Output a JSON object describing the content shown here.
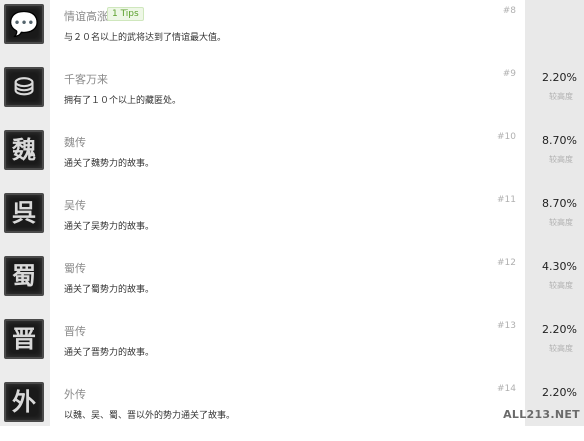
{
  "achievements": [
    {
      "icon": "speech-bubble-icon",
      "glyph": "💬",
      "title": "情谊高涨",
      "tips": "1 Tips",
      "desc": "与２０名以上的武将达到了情谊最大值。",
      "num": "#8",
      "pct": "",
      "diff": ""
    },
    {
      "icon": "treasure-icon",
      "glyph": "⛁",
      "title": "千客万来",
      "tips": "",
      "desc": "拥有了１０个以上的藏匿处。",
      "num": "#9",
      "pct": "2.20%",
      "diff": "较高度"
    },
    {
      "icon": "wei-icon",
      "glyph": "魏",
      "title": "魏传",
      "tips": "",
      "desc": "通关了魏势力的故事。",
      "num": "#10",
      "pct": "8.70%",
      "diff": "较高度"
    },
    {
      "icon": "wu-icon",
      "glyph": "呉",
      "title": "吴传",
      "tips": "",
      "desc": "通关了吴势力的故事。",
      "num": "#11",
      "pct": "8.70%",
      "diff": "较高度"
    },
    {
      "icon": "shu-icon",
      "glyph": "蜀",
      "title": "蜀传",
      "tips": "",
      "desc": "通关了蜀势力的故事。",
      "num": "#12",
      "pct": "4.30%",
      "diff": "较高度"
    },
    {
      "icon": "jin-icon",
      "glyph": "晋",
      "title": "晋传",
      "tips": "",
      "desc": "通关了晋势力的故事。",
      "num": "#13",
      "pct": "2.20%",
      "diff": "较高度"
    },
    {
      "icon": "wai-icon",
      "glyph": "外",
      "title": "外传",
      "tips": "",
      "desc": "以魏、吴、蜀、晋以外的势力通关了故事。",
      "num": "#14",
      "pct": "2.20%",
      "diff": ""
    }
  ],
  "watermark": "ALL213.NET"
}
